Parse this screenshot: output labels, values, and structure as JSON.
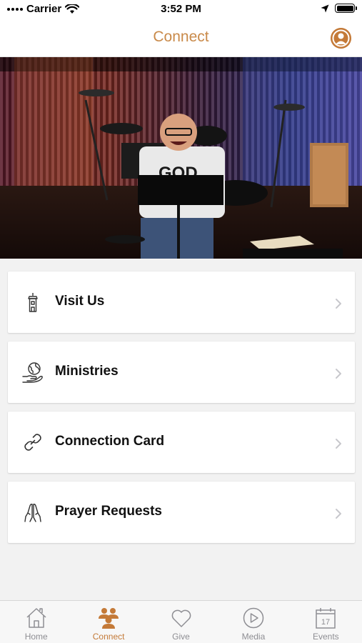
{
  "status_bar": {
    "carrier": "Carrier",
    "time": "3:52 PM"
  },
  "nav": {
    "title": "Connect"
  },
  "menu": {
    "items": [
      {
        "label": "Visit Us",
        "icon": "building-icon"
      },
      {
        "label": "Ministries",
        "icon": "globe-hand-icon"
      },
      {
        "label": "Connection Card",
        "icon": "link-icon"
      },
      {
        "label": "Prayer Requests",
        "icon": "praying-hands-icon"
      }
    ]
  },
  "tabs": [
    {
      "label": "Home",
      "icon": "home-icon",
      "active": false
    },
    {
      "label": "Connect",
      "icon": "people-icon",
      "active": true
    },
    {
      "label": "Give",
      "icon": "heart-icon",
      "active": false
    },
    {
      "label": "Media",
      "icon": "play-icon",
      "active": false
    },
    {
      "label": "Events",
      "icon": "calendar-icon",
      "active": false
    }
  ],
  "colors": {
    "accent": "#c47a38",
    "title": "#c98a4a",
    "inactive": "#8e8e93"
  }
}
